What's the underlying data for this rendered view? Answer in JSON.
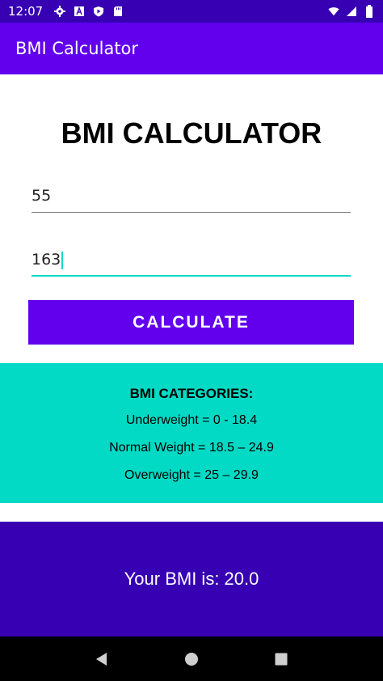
{
  "status_bar": {
    "time": "12:07",
    "left_icons": [
      "gear-icon",
      "font-a-icon",
      "shield-play-icon",
      "sd-card-icon"
    ],
    "right_icons": [
      "wifi-icon",
      "signal-icon",
      "battery-icon"
    ]
  },
  "app_bar": {
    "title": "BMI Calculator"
  },
  "main": {
    "title": "BMI CALCULATOR",
    "weight_value": "55",
    "height_value": "163",
    "calculate_label": "CALCULATE"
  },
  "categories": {
    "title": "BMI CATEGORIES:",
    "lines": [
      "Underweight = 0 - 18.4",
      "Normal Weight = 18.5 – 24.9",
      "Overweight = 25 – 29.9"
    ]
  },
  "result": {
    "text": "Your BMI is: 20.0"
  },
  "nav": {
    "icons": [
      "back-icon",
      "home-icon",
      "recents-icon"
    ]
  },
  "colors": {
    "app_bar": "#6200ee",
    "status_bar": "#3700b3",
    "accent": "#03dac5",
    "result_bg": "#3700b3"
  }
}
